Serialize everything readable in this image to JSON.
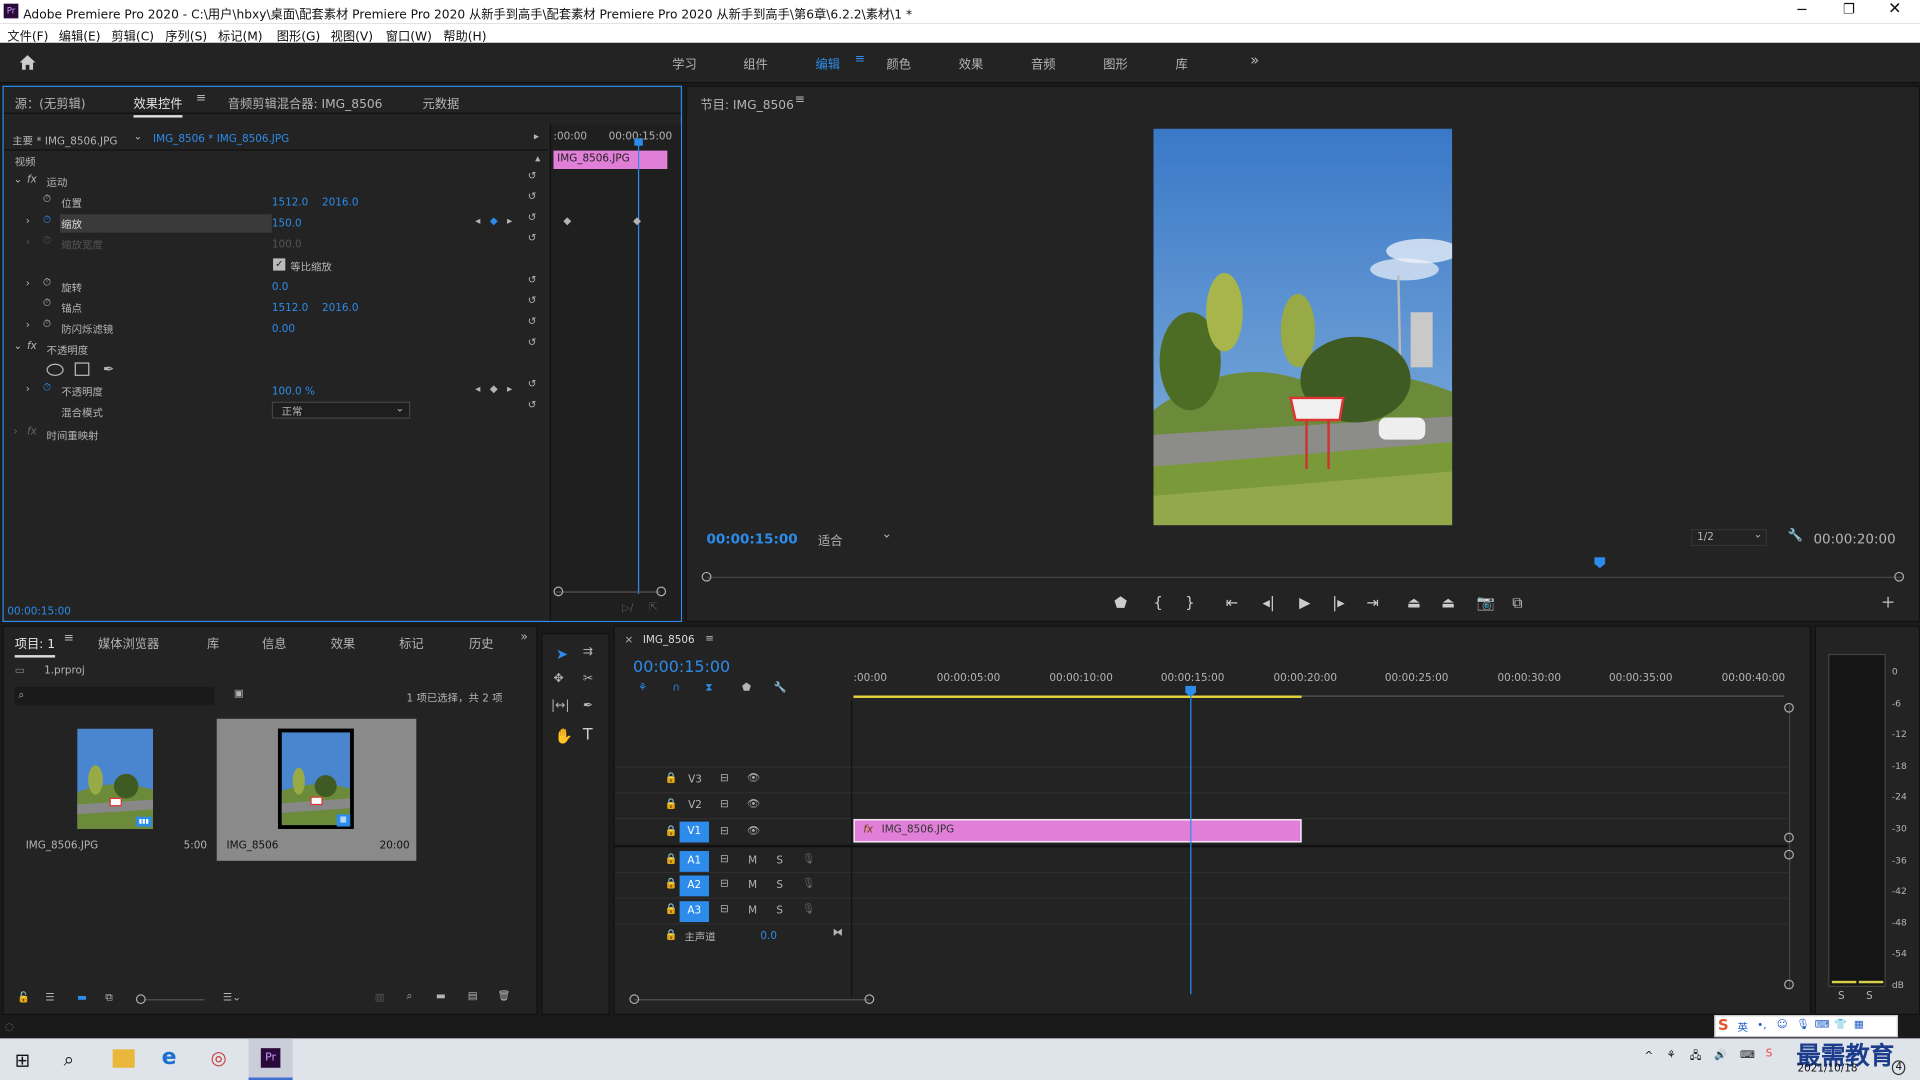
{
  "window": {
    "title": "Adobe Premiere Pro 2020 - C:\\用户\\hbxy\\桌面\\配套素材 Premiere Pro 2020 从新手到高手\\配套素材 Premiere Pro 2020 从新手到高手\\第6章\\6.2.2\\素材\\1 *",
    "app_icon": "Pr"
  },
  "menu": [
    "文件(F)",
    "编辑(E)",
    "剪辑(C)",
    "序列(S)",
    "标记(M)",
    "图形(G)",
    "视图(V)",
    "窗口(W)",
    "帮助(H)"
  ],
  "workspaces": [
    "学习",
    "组件",
    "编辑",
    "颜色",
    "效果",
    "音频",
    "图形",
    "库"
  ],
  "workspace_active": "编辑",
  "source_panel": {
    "tabs": [
      "源：(无剪辑)",
      "效果控件",
      "音频剪辑混合器: IMG_8506",
      "元数据"
    ],
    "active": "效果控件",
    "master": "主要 * IMG_8506.JPG",
    "clip": "IMG_8506 * IMG_8506.JPG",
    "mini_tc_start": ":00:00",
    "mini_tc_end": "00:00:15:00",
    "clip_label": "IMG_8506.JPG",
    "section": "视频",
    "motion": "运动",
    "opacity_group": "不透明度",
    "time_remap": "时间重映射",
    "props": {
      "position": {
        "label": "位置",
        "x": "1512.0",
        "y": "2016.0"
      },
      "scale": {
        "label": "缩放",
        "value": "150.0"
      },
      "scale_width": {
        "label": "缩放宽度",
        "value": "100.0"
      },
      "uniform": {
        "label": "等比缩放"
      },
      "rotation": {
        "label": "旋转",
        "value": "0.0"
      },
      "anchor": {
        "label": "锚点",
        "x": "1512.0",
        "y": "2016.0"
      },
      "flicker": {
        "label": "防闪烁滤镜",
        "value": "0.00"
      },
      "opacity": {
        "label": "不透明度",
        "value": "100.0 %"
      },
      "blend": {
        "label": "混合模式",
        "value": "正常"
      }
    },
    "timecode": "00:00:15:00"
  },
  "program": {
    "title": "节目: IMG_8506",
    "timecode": "00:00:15:00",
    "fit": "适合",
    "resolution": "1/2",
    "duration": "00:00:20:00"
  },
  "project": {
    "tabs": [
      "项目: 1",
      "媒体浏览器",
      "库",
      "信息",
      "效果",
      "标记",
      "历史"
    ],
    "file": "1.prproj",
    "search_placeholder": "",
    "count": "1 项已选择，共 2 项",
    "items": [
      {
        "name": "IMG_8506.JPG",
        "dur": "5:00"
      },
      {
        "name": "IMG_8506",
        "dur": "20:00"
      }
    ]
  },
  "timeline": {
    "title": "IMG_8506",
    "timecode": "00:00:15:00",
    "ruler": [
      ":00:00",
      "00:00:05:00",
      "00:00:10:00",
      "00:00:15:00",
      "00:00:20:00",
      "00:00:25:00",
      "00:00:30:00",
      "00:00:35:00",
      "00:00:40:00"
    ],
    "video_tracks": [
      "V3",
      "V2",
      "V1"
    ],
    "audio_tracks": [
      "A1",
      "A2",
      "A3"
    ],
    "master_label": "主声道",
    "master_value": "0.0",
    "clip_name": "IMG_8506.JPG",
    "playhead_sec": 15,
    "clip_end_sec": 20
  },
  "meter": {
    "scale": [
      "0",
      "-6",
      "-12",
      "-18",
      "-24",
      "-30",
      "-36",
      "-42",
      "-48",
      "-54",
      "dB"
    ],
    "solo": [
      "S",
      "S"
    ]
  },
  "taskbar": {
    "date": "2021/10/18",
    "ime": "英",
    "watermark": "最需教育",
    "corner_badge": "4"
  },
  "colors": {
    "accent": "#2d8ceb",
    "clip": "#e17fd8",
    "panel": "#232323",
    "bg": "#1a1a1a",
    "inout": "#e6d23c"
  }
}
